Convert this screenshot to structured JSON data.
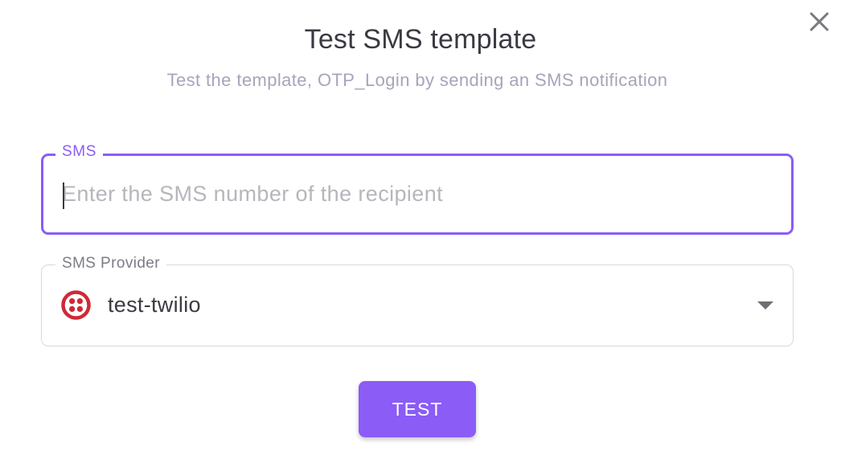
{
  "dialog": {
    "title": "Test SMS template",
    "subtitle": "Test the template, OTP_Login by sending an SMS notification"
  },
  "sms_field": {
    "label": "SMS",
    "value": "",
    "placeholder": "Enter the SMS number of the recipient"
  },
  "provider_field": {
    "label": "SMS Provider",
    "selected": "test-twilio",
    "logo_icon": "twilio-logo-icon"
  },
  "actions": {
    "test_label": "TEST"
  },
  "colors": {
    "accent": "#8b5cf6",
    "twilio_red": "#cf2a36"
  }
}
